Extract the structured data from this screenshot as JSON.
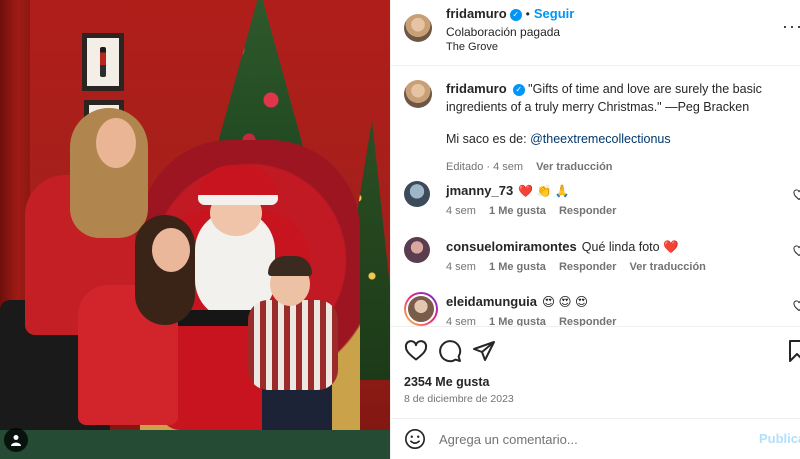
{
  "post": {
    "username": "fridamuro",
    "follow_label": "Seguir",
    "separator": "•",
    "paid_partnership": "Colaboración pagada",
    "location": "The Grove",
    "more_label": "···"
  },
  "caption": {
    "username": "fridamuro",
    "quote": "\"Gifts of time and love are surely the basic ingredients of a truly merry Christmas.\" —Peg Bracken",
    "suit_prefix": "Mi saco es de: ",
    "suit_mention": "@theextremecollectionus",
    "edited": "Editado · 4 sem",
    "see_translation": "Ver traducción"
  },
  "comments": [
    {
      "username": "jmanny_73",
      "text": "❤️ 👏 🙏",
      "time": "4 sem",
      "likes": "1 Me gusta",
      "reply": "Responder",
      "translation": ""
    },
    {
      "username": "consuelomiramontes",
      "text": "Qué linda foto ❤️",
      "time": "4 sem",
      "likes": "1 Me gusta",
      "reply": "Responder",
      "translation": "Ver traducción"
    },
    {
      "username": "eleidamunguia",
      "text": "😍 😍 😍",
      "time": "4 sem",
      "likes": "1 Me gusta",
      "reply": "Responder",
      "translation": ""
    }
  ],
  "actions": {
    "likes": "2354 Me gusta",
    "date": "8 de diciembre de 2023"
  },
  "composer": {
    "placeholder": "Agrega un comentario...",
    "publish": "Publicar"
  },
  "colors": {
    "accent": "#0095f6",
    "link": "#00376b",
    "muted": "#737373",
    "publish_disabled": "#b2dffc"
  },
  "icons": [
    "verified-icon",
    "more-icon",
    "heart-icon",
    "comment-icon",
    "share-icon",
    "save-icon",
    "emoji-icon",
    "user-tag-icon"
  ]
}
